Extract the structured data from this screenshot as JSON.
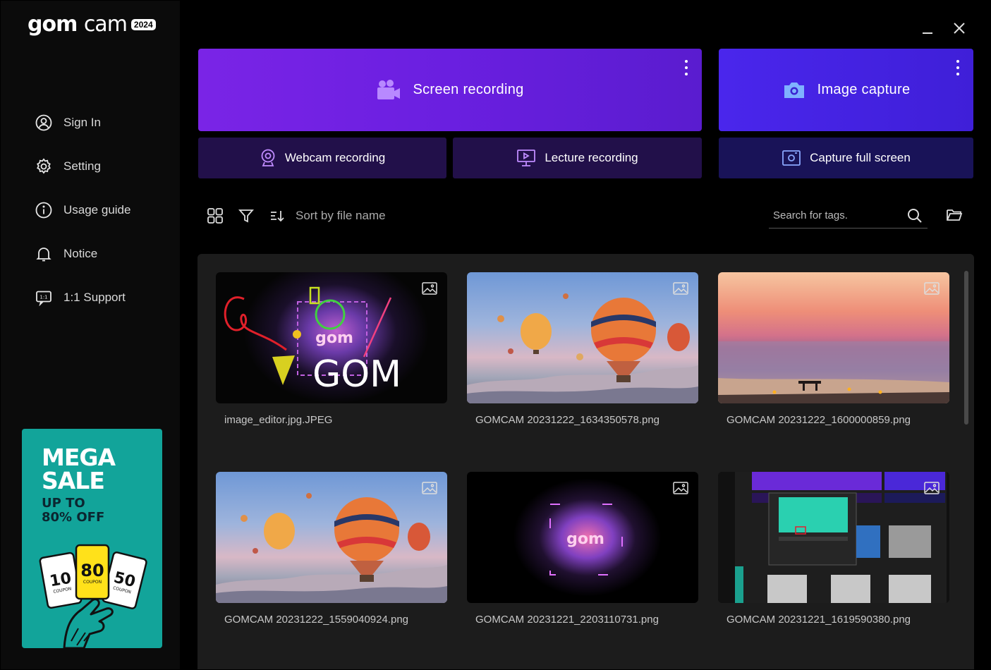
{
  "app": {
    "logo_word": "gom",
    "logo_word2": "cam",
    "logo_badge": "2024"
  },
  "sidebar": {
    "items": [
      {
        "label": "Sign In",
        "icon": "user-circle-icon"
      },
      {
        "label": "Setting",
        "icon": "gear-icon"
      },
      {
        "label": "Usage guide",
        "icon": "info-icon"
      },
      {
        "label": "Notice",
        "icon": "bell-icon"
      },
      {
        "label": "1:1 Support",
        "icon": "support-chat-icon"
      }
    ],
    "promo": {
      "line1": "MEGA",
      "line2": "SALE",
      "line3": "UP TO",
      "line4": "80% OFF",
      "coupons": [
        "10",
        "80",
        "50"
      ],
      "coupon_text": "COUPON"
    }
  },
  "actions": {
    "screen_recording": "Screen recording",
    "image_capture": "Image capture",
    "webcam_recording": "Webcam recording",
    "lecture_recording": "Lecture recording",
    "capture_full_screen": "Capture full screen"
  },
  "toolbar": {
    "sort_label": "Sort by file name",
    "search_placeholder": "Search for tags."
  },
  "files": [
    {
      "name": "image_editor.jpg.JPEG",
      "thumb_text": "GOM"
    },
    {
      "name": "GOMCAM 20231222_1634350578.png"
    },
    {
      "name": "GOMCAM 20231222_1600000859.png"
    },
    {
      "name": "GOMCAM 20231222_1559040924.png"
    },
    {
      "name": "GOMCAM 20231221_2203110731.png"
    },
    {
      "name": "GOMCAM 20231221_1619590380.png"
    }
  ],
  "colors": {
    "screen_recording_bg": "#6a1fe0",
    "image_capture_bg": "#4420e8",
    "secondary_btn_bg": "#21104a",
    "capture_full_btn_bg": "#18135a",
    "promo_bg": "#12a49a"
  }
}
